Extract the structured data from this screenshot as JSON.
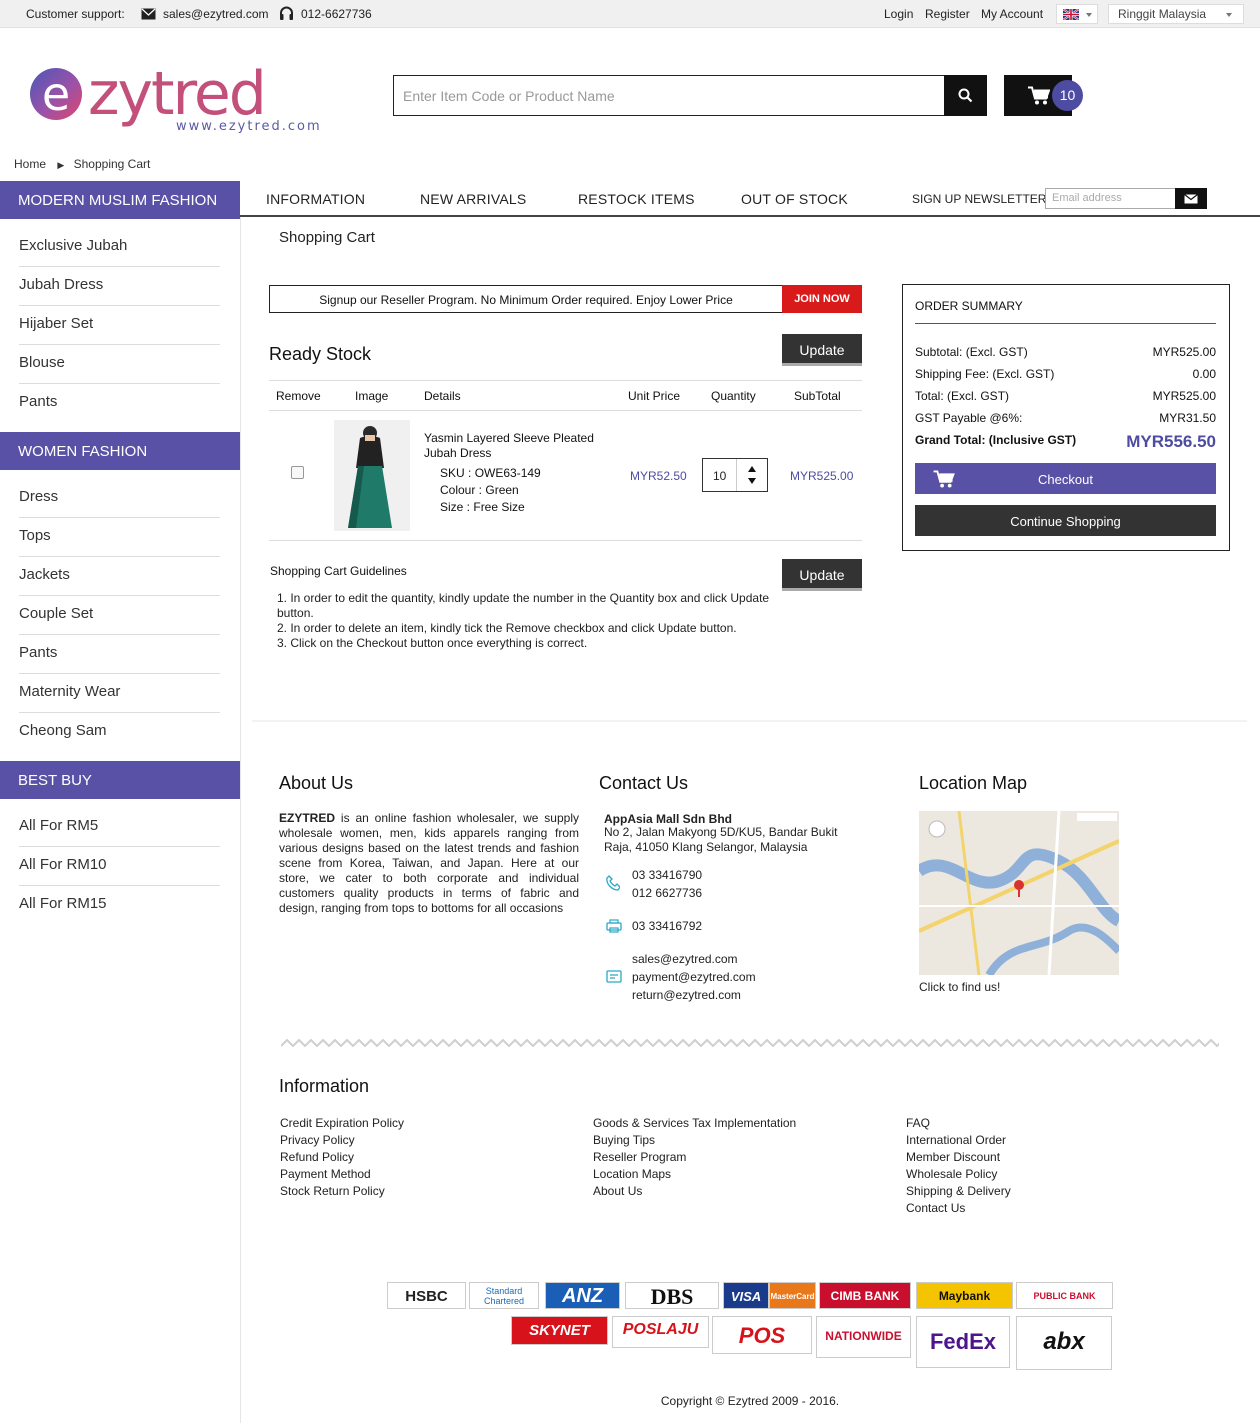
{
  "topbar": {
    "support_label": "Customer support:",
    "email": "sales@ezytred.com",
    "phone": "012-6627736",
    "login": "Login",
    "register": "Register",
    "my_account": "My Account",
    "currency": "Ringgit Malaysia"
  },
  "header": {
    "logo_text": "ezytred",
    "logo_url_text": "www.ezytred.com",
    "search_placeholder": "Enter Item Code or Product Name",
    "cart_count": "10"
  },
  "breadcrumb": {
    "home": "Home",
    "current": "Shopping Cart"
  },
  "sidebar": {
    "sections": [
      {
        "title": "MODERN MUSLIM FASHION",
        "items": [
          "Exclusive Jubah",
          "Jubah Dress",
          "Hijaber Set",
          "Blouse",
          "Pants"
        ]
      },
      {
        "title": "WOMEN FASHION",
        "items": [
          "Dress",
          "Tops",
          "Jackets",
          "Couple Set",
          "Pants",
          "Maternity Wear",
          "Cheong Sam"
        ]
      },
      {
        "title": "BEST BUY",
        "items": [
          "All For RM5",
          "All For RM10",
          "All For RM15"
        ]
      }
    ]
  },
  "nav": {
    "items": [
      "INFORMATION",
      "NEW ARRIVALS",
      "RESTOCK ITEMS",
      "OUT OF STOCK"
    ],
    "newsletter_label": "SIGN UP NEWSLETTER",
    "newsletter_placeholder": "Email address"
  },
  "cart": {
    "page_title": "Shopping Cart",
    "promo_text": "Signup our Reseller Program. No Minimum Order required. Enjoy Lower Price",
    "join_label": "JOIN NOW",
    "section_title": "Ready Stock",
    "update_label": "Update",
    "columns": [
      "Remove",
      "Image",
      "Details",
      "Unit Price",
      "Quantity",
      "SubTotal"
    ],
    "item": {
      "name": "Yasmin Layered Sleeve Pleated Jubah Dress",
      "sku_label": "SKU :",
      "sku": "OWE63-149",
      "colour_label": "Colour :",
      "colour": "Green",
      "size_label": "Size :",
      "size": "Free Size",
      "unit_price": "MYR52.50",
      "quantity": "10",
      "subtotal": "MYR525.00"
    },
    "guide_title": "Shopping Cart Guidelines",
    "guide": [
      "1. In order to edit the quantity, kindly update the number in the Quantity box and click Update button.",
      "2. In order to delete an item, kindly tick the Remove checkbox and click Update button.",
      "3. Click on the Checkout button once everything is correct."
    ]
  },
  "summary": {
    "title": "ORDER SUMMARY",
    "rows": [
      {
        "label": "Subtotal: (Excl. GST)",
        "value": "MYR525.00"
      },
      {
        "label": "Shipping Fee: (Excl. GST)",
        "value": "0.00"
      },
      {
        "label": "Total: (Excl. GST)",
        "value": "MYR525.00"
      },
      {
        "label": "GST Payable @6%:",
        "value": "MYR31.50"
      }
    ],
    "grand_label": "Grand Total: (Inclusive GST)",
    "grand_value": "MYR556.50",
    "checkout_label": "Checkout",
    "continue_label": "Continue Shopping"
  },
  "footer": {
    "about_title": "About Us",
    "about_brand": "EZYTRED",
    "about_text": " is an online fashion wholesaler, we supply wholesale women, men, kids apparels ranging from various designs based on the latest trends and fashion scene from Korea, Taiwan, and Japan. Here at our store, we cater to both corporate and individual customers quality products in terms of fabric and design, ranging from tops to bottoms for all occasions",
    "contact_title": "Contact Us",
    "company": "AppAsia Mall Sdn Bhd",
    "address": "No 2, Jalan Makyong 5D/KU5, Bandar Bukit Raja, 41050 Klang Selangor, Malaysia",
    "phone1": "03 33416790",
    "phone2": "012 6627736",
    "fax": "03 33416792",
    "email1": "sales@ezytred.com",
    "email2": "payment@ezytred.com",
    "email3": "return@ezytred.com",
    "map_title": "Location Map",
    "map_caption": "Click to find us!",
    "info_title": "Information",
    "info_col1": [
      "Credit Expiration Policy",
      "Privacy Policy",
      "Refund Policy",
      "Payment Method",
      "Stock Return Policy"
    ],
    "info_col2": [
      "Goods & Services Tax Implementation",
      "Buying Tips",
      "Reseller Program",
      "Location Maps",
      "About Us"
    ],
    "info_col3": [
      "FAQ",
      "International Order",
      "Member Discount",
      "Wholesale Policy",
      "Shipping & Delivery",
      "Contact Us"
    ],
    "payment_logos": [
      "HSBC",
      "Standard Chartered",
      "ANZ",
      "DBS",
      "VISA",
      "MasterCard",
      "CIMB BANK",
      "Maybank",
      "PUBLIC BANK"
    ],
    "courier_logos": [
      "SKYNET",
      "POSLAJU",
      "POS",
      "NATIONWIDE",
      "FedEx",
      "abx"
    ],
    "copyright": "Copyright © Ezytred 2009 - 2016."
  },
  "colors": {
    "accent": "#5851a5",
    "price": "#4e4ba2",
    "join": "#d91a1a",
    "dark": "#333333"
  }
}
